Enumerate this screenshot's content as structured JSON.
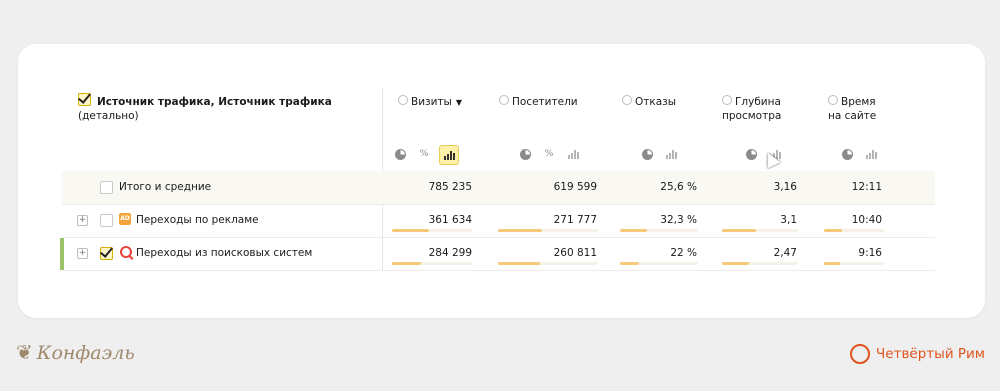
{
  "dimension": {
    "title_bold": "Источник трафика, Источник трафика",
    "title_cont": "(детально)"
  },
  "columns": [
    {
      "label1": "Визиты",
      "label2": "",
      "sort": "▼"
    },
    {
      "label1": "Посетители",
      "label2": ""
    },
    {
      "label1": "Отказы",
      "label2": ""
    },
    {
      "label1": "Глубина",
      "label2": "просмотра"
    },
    {
      "label1": "Время",
      "label2": "на сайте"
    }
  ],
  "toolbar_glyphs": {
    "percent": "%"
  },
  "rows": [
    {
      "label": "Итого и средние",
      "visits": "785 235",
      "visitors": "619 599",
      "bounce": "25,6 %",
      "depth": "3,16",
      "time": "12:11"
    },
    {
      "label": "Переходы по рекламе",
      "badge": "AD",
      "visits": "361 634",
      "visitors": "271 777",
      "bounce": "32,3 %",
      "depth": "3,1",
      "time": "10:40",
      "bars": {
        "visits": 0.46,
        "visitors": 0.44,
        "bounce": 0.35,
        "depth": 0.45,
        "time": 0.3
      }
    },
    {
      "label": "Переходы из поисковых систем",
      "visits": "284 299",
      "visitors": "260 811",
      "bounce": "22 %",
      "depth": "2,47",
      "time": "9:16",
      "bars": {
        "visits": 0.36,
        "visitors": 0.42,
        "bounce": 0.24,
        "depth": 0.36,
        "time": 0.26
      }
    }
  ],
  "footer": {
    "left_brand": "Конфаэль",
    "right_brand": "Четвёртый Рим"
  },
  "colors": {
    "accent": "#f6c978",
    "highlight": "#fff1a8",
    "brand_right": "#e0541e",
    "brand_left": "#a08a6c",
    "row_marker": "#9bc36a"
  }
}
